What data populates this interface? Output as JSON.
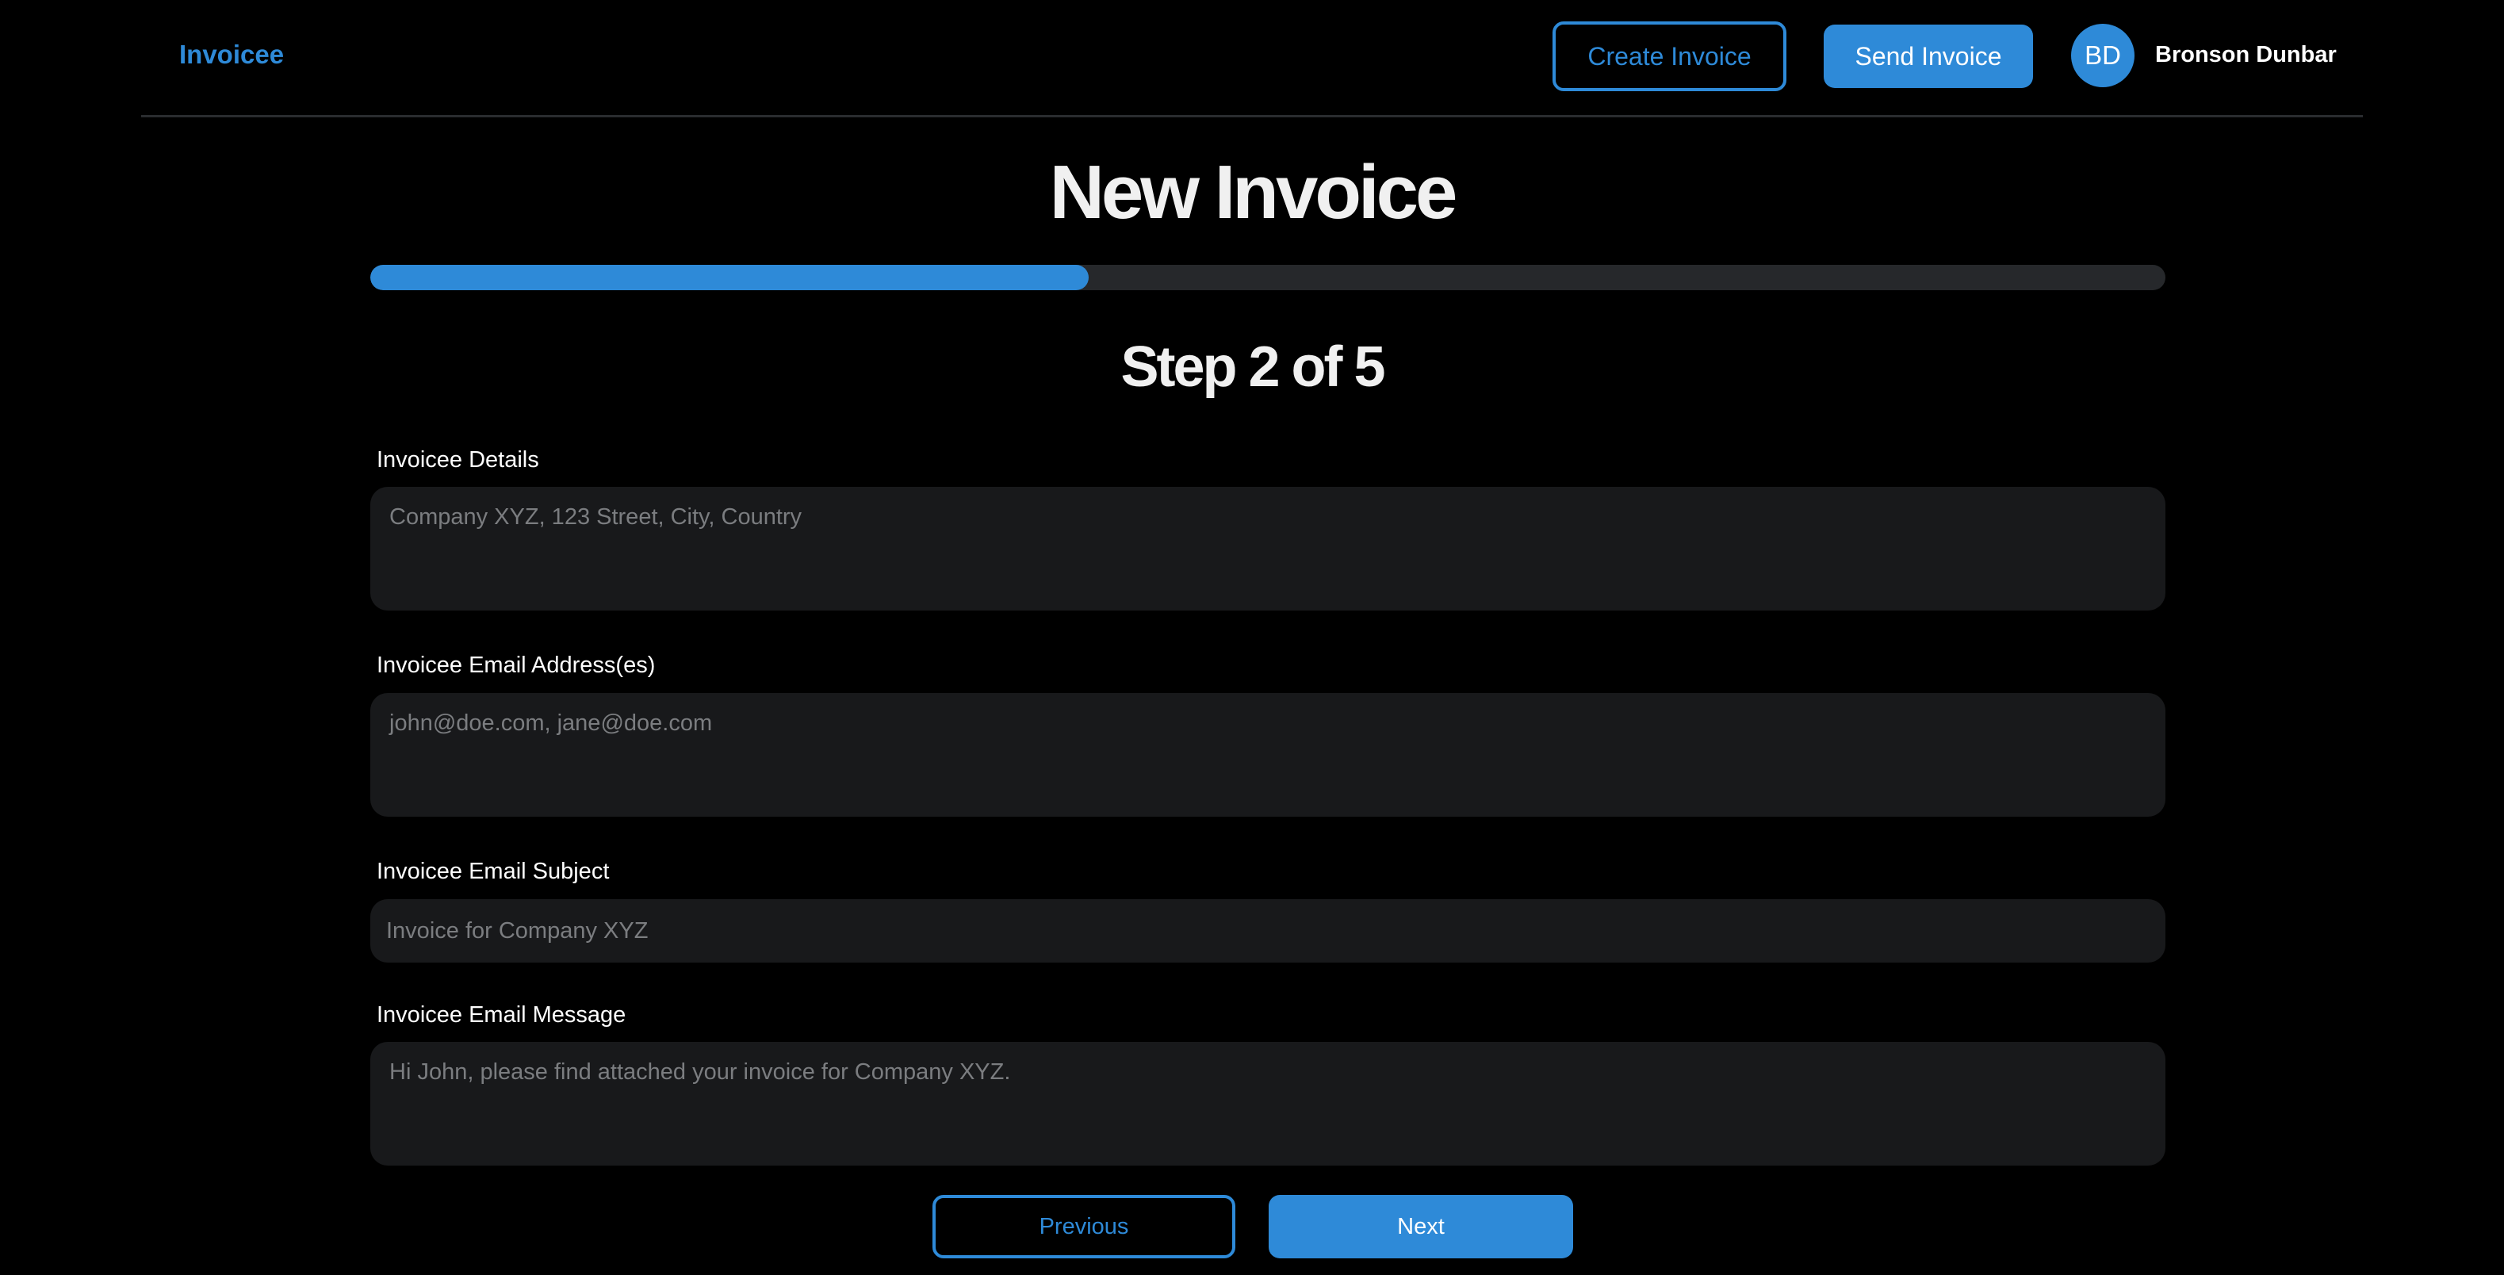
{
  "header": {
    "brand": "Invoicee",
    "create_invoice_label": "Create Invoice",
    "send_invoice_label": "Send Invoice",
    "user_initials": "BD",
    "user_name": "Bronson Dunbar"
  },
  "main": {
    "title": "New Invoice",
    "progress_fraction": 0.4,
    "step_text": "Step 2 of 5"
  },
  "form": {
    "details": {
      "label": "Invoicee Details",
      "placeholder": "Company XYZ, 123 Street, City, Country",
      "value": ""
    },
    "emails": {
      "label": "Invoicee Email Address(es)",
      "placeholder": "john@doe.com, jane@doe.com",
      "value": ""
    },
    "subject": {
      "label": "Invoicee Email Subject",
      "placeholder": "Invoice for Company XYZ",
      "value": ""
    },
    "message": {
      "label": "Invoicee Email Message",
      "placeholder": "Hi John, please find attached your invoice for Company XYZ.",
      "value": ""
    }
  },
  "footer": {
    "previous_label": "Previous",
    "next_label": "Next"
  },
  "colors": {
    "accent": "#2e8ad8",
    "background": "#000000",
    "field_background": "#18191b",
    "track": "#26282b"
  }
}
